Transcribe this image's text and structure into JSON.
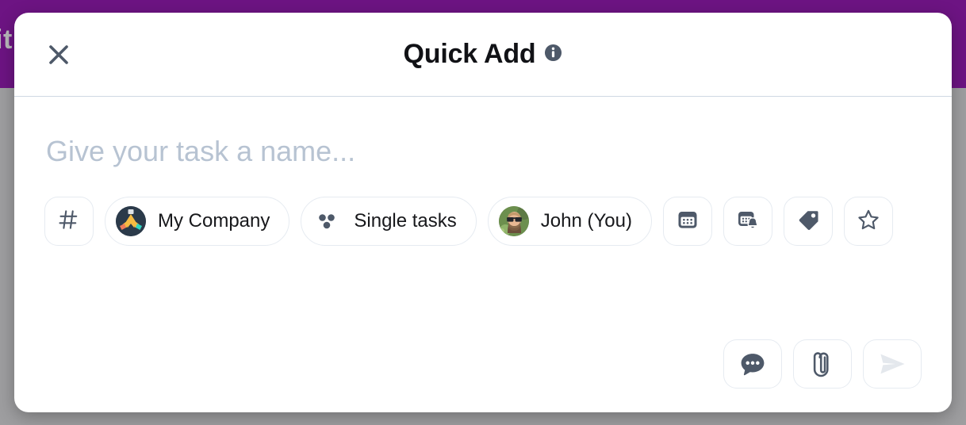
{
  "backdrop": {
    "partial_text": "it",
    "bar_color": "#6d1483",
    "page_background": "#9e9ea0"
  },
  "dialog": {
    "header": {
      "title": "Quick Add",
      "close_icon": "close-icon",
      "info_icon": "info-icon"
    },
    "task_input": {
      "placeholder": "Give your task a name...",
      "value": ""
    },
    "chips": [
      {
        "name": "hashtag-button",
        "icon": "hashtag-icon",
        "label": ""
      },
      {
        "name": "workspace-chip",
        "icon": "handshake-avatar",
        "label": "My Company"
      },
      {
        "name": "task-type-chip",
        "icon": "three-dots-icon",
        "label": "Single tasks"
      },
      {
        "name": "assignee-chip",
        "icon": "person-avatar",
        "label": "John (You)"
      },
      {
        "name": "due-date-button",
        "icon": "calendar-icon",
        "label": ""
      },
      {
        "name": "reminder-button",
        "icon": "calendar-bell-icon",
        "label": ""
      },
      {
        "name": "tag-button",
        "icon": "tag-icon",
        "label": ""
      },
      {
        "name": "priority-button",
        "icon": "star-icon",
        "label": ""
      }
    ],
    "footer_actions": [
      {
        "name": "comment-button",
        "icon": "comment-icon",
        "state": "enabled"
      },
      {
        "name": "attachment-button",
        "icon": "paperclip-icon",
        "state": "enabled"
      },
      {
        "name": "send-button",
        "icon": "send-icon",
        "state": "disabled"
      }
    ]
  },
  "colors": {
    "accent_purple": "#6d1483",
    "icon_slate": "#4e5969",
    "placeholder": "#b7c3d2",
    "border": "#e6ebf1",
    "divider": "#cfd8e3",
    "send_disabled": "#e4e8ed"
  }
}
